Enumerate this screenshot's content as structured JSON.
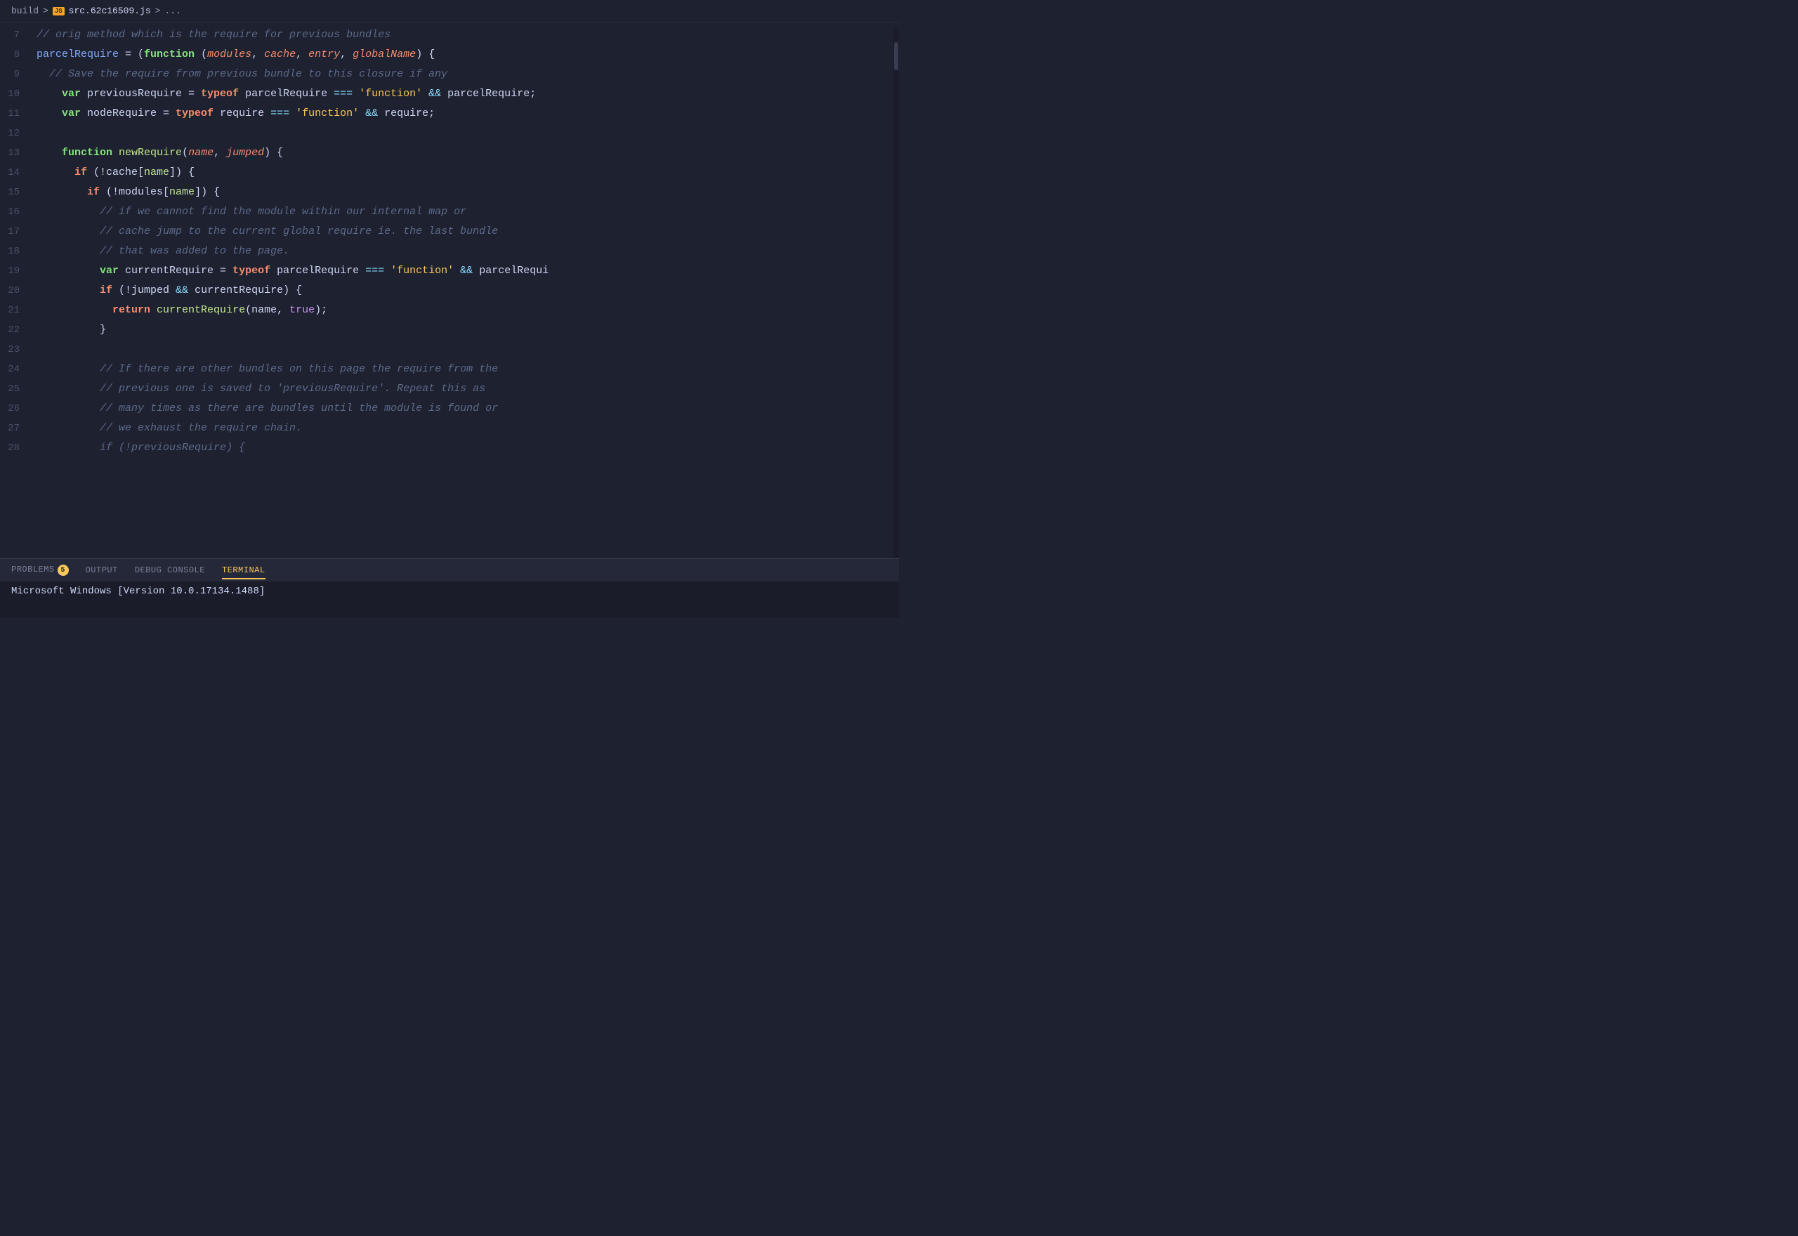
{
  "breadcrumb": {
    "build": "build",
    "sep1": ">",
    "js_icon": "JS",
    "filename": "src.62c16509.js",
    "sep2": ">",
    "dots": "..."
  },
  "panel": {
    "tabs": [
      {
        "id": "problems",
        "label": "PROBLEMS",
        "badge": "5",
        "active": false
      },
      {
        "id": "output",
        "label": "OUTPUT",
        "badge": "",
        "active": false
      },
      {
        "id": "debug-console",
        "label": "DEBUG CONSOLE",
        "badge": "",
        "active": false
      },
      {
        "id": "terminal",
        "label": "TERMINAL",
        "badge": "",
        "active": true
      }
    ],
    "terminal_text": "Microsoft Windows [Version 10.0.17134.1488]"
  },
  "lines": [
    {
      "num": "7",
      "tokens": [
        {
          "t": "c-comment",
          "v": "// orig method which is the require for previous bundles"
        }
      ]
    },
    {
      "num": "8",
      "tokens": [
        {
          "t": "c-var",
          "v": "parcelRequire"
        },
        {
          "t": "c-plain",
          "v": " = ("
        },
        {
          "t": "c-keyword",
          "v": "function"
        },
        {
          "t": "c-plain",
          "v": " ("
        },
        {
          "t": "c-param",
          "v": "modules"
        },
        {
          "t": "c-plain",
          "v": ", "
        },
        {
          "t": "c-param",
          "v": "cache"
        },
        {
          "t": "c-plain",
          "v": ", "
        },
        {
          "t": "c-param",
          "v": "entry"
        },
        {
          "t": "c-plain",
          "v": ", "
        },
        {
          "t": "c-param",
          "v": "globalName"
        },
        {
          "t": "c-plain",
          "v": ") {"
        }
      ]
    },
    {
      "num": "9",
      "tokens": [
        {
          "t": "c-comment",
          "v": "  // Save the require from previous bundle to this closure if any"
        }
      ]
    },
    {
      "num": "10",
      "tokens": [
        {
          "t": "c-keyword",
          "v": "    var"
        },
        {
          "t": "c-plain",
          "v": " previousRequire = "
        },
        {
          "t": "c-keyword2",
          "v": "typeof"
        },
        {
          "t": "c-plain",
          "v": " parcelRequire "
        },
        {
          "t": "c-op",
          "v": "==="
        },
        {
          "t": "c-plain",
          "v": " "
        },
        {
          "t": "c-string",
          "v": "'function'"
        },
        {
          "t": "c-plain",
          "v": " "
        },
        {
          "t": "c-op",
          "v": "&&"
        },
        {
          "t": "c-plain",
          "v": " parcelRequire;"
        }
      ]
    },
    {
      "num": "11",
      "tokens": [
        {
          "t": "c-keyword",
          "v": "    var"
        },
        {
          "t": "c-plain",
          "v": " nodeRequire = "
        },
        {
          "t": "c-keyword2",
          "v": "typeof"
        },
        {
          "t": "c-plain",
          "v": " require "
        },
        {
          "t": "c-op",
          "v": "==="
        },
        {
          "t": "c-plain",
          "v": " "
        },
        {
          "t": "c-string",
          "v": "'function'"
        },
        {
          "t": "c-plain",
          "v": " "
        },
        {
          "t": "c-op",
          "v": "&&"
        },
        {
          "t": "c-plain",
          "v": " require;"
        }
      ]
    },
    {
      "num": "12",
      "tokens": []
    },
    {
      "num": "13",
      "tokens": [
        {
          "t": "c-keyword",
          "v": "    function"
        },
        {
          "t": "c-plain",
          "v": " "
        },
        {
          "t": "c-func",
          "v": "newRequire"
        },
        {
          "t": "c-plain",
          "v": "("
        },
        {
          "t": "c-param",
          "v": "name"
        },
        {
          "t": "c-plain",
          "v": ", "
        },
        {
          "t": "c-param",
          "v": "jumped"
        },
        {
          "t": "c-plain",
          "v": ") {"
        }
      ]
    },
    {
      "num": "14",
      "tokens": [
        {
          "t": "c-keyword2",
          "v": "      if"
        },
        {
          "t": "c-plain",
          "v": " (!cache["
        },
        {
          "t": "c-func",
          "v": "name"
        },
        {
          "t": "c-plain",
          "v": "]) {"
        }
      ]
    },
    {
      "num": "15",
      "tokens": [
        {
          "t": "c-keyword2",
          "v": "        if"
        },
        {
          "t": "c-plain",
          "v": " (!modules["
        },
        {
          "t": "c-func",
          "v": "name"
        },
        {
          "t": "c-plain",
          "v": "]) {"
        }
      ]
    },
    {
      "num": "16",
      "tokens": [
        {
          "t": "c-comment",
          "v": "          // if we cannot find the module within our internal map or"
        }
      ]
    },
    {
      "num": "17",
      "tokens": [
        {
          "t": "c-comment",
          "v": "          // cache jump to the current global require ie. the last bundle"
        }
      ]
    },
    {
      "num": "18",
      "tokens": [
        {
          "t": "c-comment",
          "v": "          // that was added to the page."
        }
      ]
    },
    {
      "num": "19",
      "tokens": [
        {
          "t": "c-keyword",
          "v": "          var"
        },
        {
          "t": "c-plain",
          "v": " currentRequire = "
        },
        {
          "t": "c-keyword2",
          "v": "typeof"
        },
        {
          "t": "c-plain",
          "v": " parcelRequire "
        },
        {
          "t": "c-op",
          "v": "==="
        },
        {
          "t": "c-plain",
          "v": " "
        },
        {
          "t": "c-string",
          "v": "'function'"
        },
        {
          "t": "c-plain",
          "v": " "
        },
        {
          "t": "c-op",
          "v": "&&"
        },
        {
          "t": "c-plain",
          "v": " parcelRequi"
        }
      ]
    },
    {
      "num": "20",
      "tokens": [
        {
          "t": "c-keyword2",
          "v": "          if"
        },
        {
          "t": "c-plain",
          "v": " (!jumped "
        },
        {
          "t": "c-op",
          "v": "&&"
        },
        {
          "t": "c-plain",
          "v": " currentRequire) {"
        }
      ]
    },
    {
      "num": "21",
      "tokens": [
        {
          "t": "c-keyword2",
          "v": "            return"
        },
        {
          "t": "c-plain",
          "v": " "
        },
        {
          "t": "c-func",
          "v": "currentRequire"
        },
        {
          "t": "c-plain",
          "v": "(name, "
        },
        {
          "t": "c-bool",
          "v": "true"
        },
        {
          "t": "c-plain",
          "v": ");"
        }
      ]
    },
    {
      "num": "22",
      "tokens": [
        {
          "t": "c-plain",
          "v": "          }"
        }
      ]
    },
    {
      "num": "23",
      "tokens": []
    },
    {
      "num": "24",
      "tokens": [
        {
          "t": "c-comment",
          "v": "          // If there are other bundles on this page the require from the"
        }
      ]
    },
    {
      "num": "25",
      "tokens": [
        {
          "t": "c-comment",
          "v": "          // previous one is saved to 'previousRequire'. Repeat this as"
        }
      ]
    },
    {
      "num": "26",
      "tokens": [
        {
          "t": "c-comment",
          "v": "          // many times as there are bundles until the module is found or"
        }
      ]
    },
    {
      "num": "27",
      "tokens": [
        {
          "t": "c-comment",
          "v": "          // we exhaust the require chain."
        }
      ]
    },
    {
      "num": "28",
      "tokens": [
        {
          "t": "c-comment",
          "v": "          if (!previousRequire) {"
        }
      ]
    }
  ]
}
